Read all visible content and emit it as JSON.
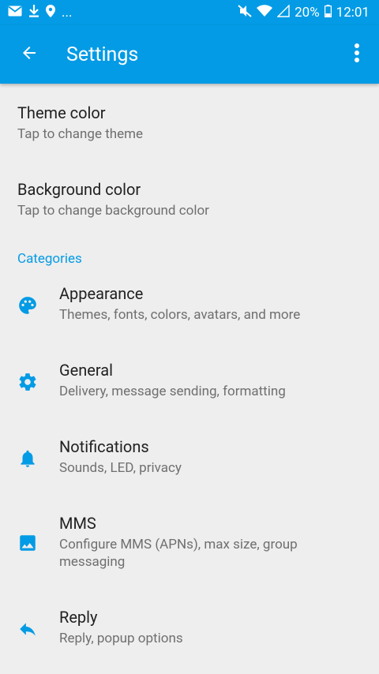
{
  "status_bar": {
    "ellipsis": "...",
    "battery": "20%",
    "time": "12:01"
  },
  "app_bar": {
    "title": "Settings"
  },
  "plain_items": [
    {
      "title": "Theme color",
      "subtitle": "Tap to change theme"
    },
    {
      "title": "Background color",
      "subtitle": "Tap to change background color"
    }
  ],
  "categories": {
    "header": "Categories",
    "items": [
      {
        "title": "Appearance",
        "subtitle": "Themes, fonts, colors, avatars, and more",
        "icon": "palette-icon"
      },
      {
        "title": "General",
        "subtitle": "Delivery, message sending, formatting",
        "icon": "gear-icon"
      },
      {
        "title": "Notifications",
        "subtitle": "Sounds, LED, privacy",
        "icon": "bell-icon"
      },
      {
        "title": "MMS",
        "subtitle": "Configure MMS (APNs), max size, group messaging",
        "icon": "image-icon"
      },
      {
        "title": "Reply",
        "subtitle": "Reply, popup options",
        "icon": "reply-icon"
      }
    ]
  },
  "colors": {
    "accent": "#039be5",
    "background": "#eeeeee"
  }
}
